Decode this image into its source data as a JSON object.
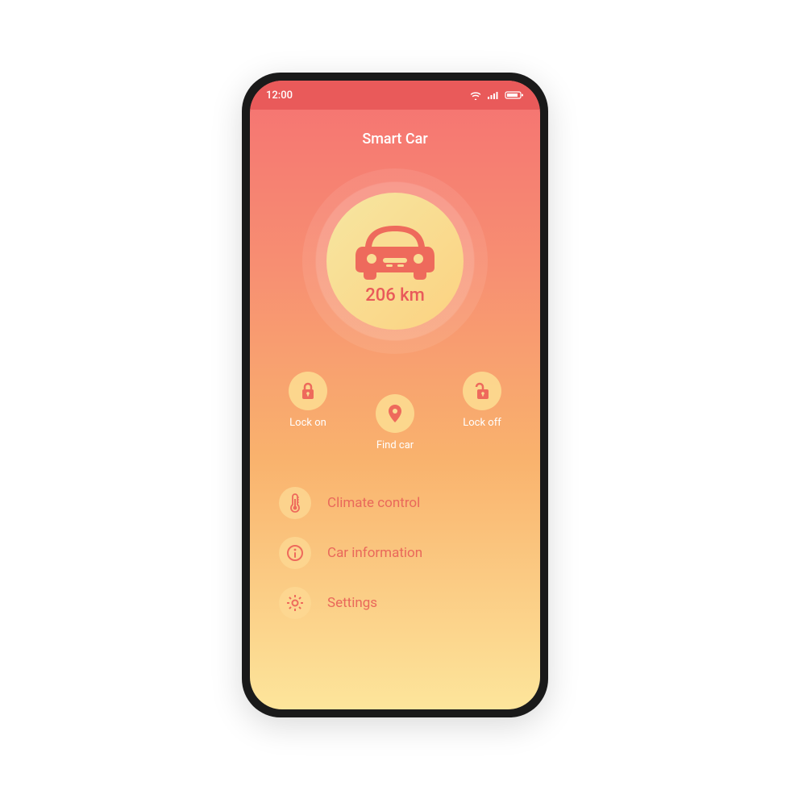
{
  "status": {
    "time": "12:00"
  },
  "app": {
    "title": "Smart Car"
  },
  "range": {
    "display": "206 km"
  },
  "quick": {
    "lock_on": {
      "label": "Lock on"
    },
    "find_car": {
      "label": "Find car"
    },
    "lock_off": {
      "label": "Lock off"
    }
  },
  "menu": {
    "climate": {
      "label": "Climate control"
    },
    "info": {
      "label": "Car information"
    },
    "settings": {
      "label": "Settings"
    }
  },
  "colors": {
    "accent": "#e95a5a",
    "gradient_top": "#f57272",
    "gradient_bottom": "#fde59b"
  }
}
